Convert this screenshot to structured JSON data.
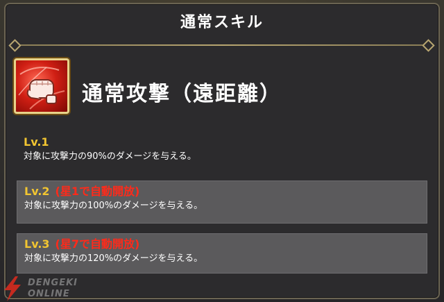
{
  "panel": {
    "title": "通常スキル"
  },
  "skill": {
    "icon": "fist-punch-icon",
    "name": "通常攻撃（遠距離）"
  },
  "levels": [
    {
      "label": "Lv.1",
      "note": "",
      "description": "対象に攻撃力の90%のダメージを与える。"
    },
    {
      "label": "Lv.2",
      "note": "(星1で自動開放)",
      "description": "対象に攻撃力の100%のダメージを与える。"
    },
    {
      "label": "Lv.3",
      "note": "(星7で自動開放)",
      "description": "対象に攻撃力の120%のダメージを与える。"
    }
  ],
  "watermark": {
    "line1": "DENGEKI",
    "line2": "ONLINE"
  },
  "colors": {
    "level_label": "#f2c531",
    "unlock_note": "#ff2a1a",
    "accent_gold": "#b8a671",
    "icon_red": "#d01f14"
  }
}
